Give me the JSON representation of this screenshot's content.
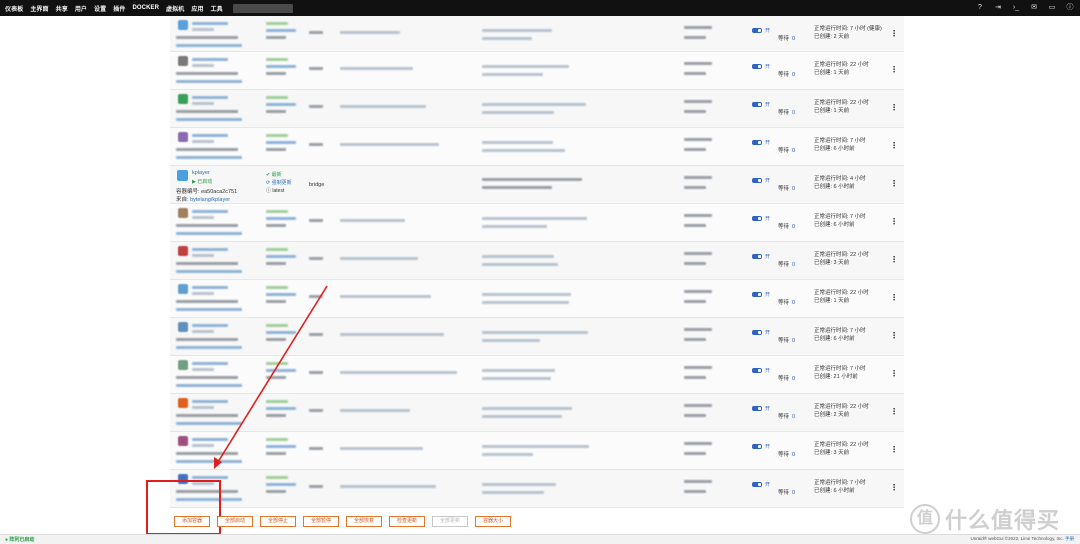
{
  "nav": {
    "items": [
      "仪表板",
      "主界面",
      "共享",
      "用户",
      "设置",
      "插件",
      "DOCKER",
      "虚拟机",
      "应用",
      "工具"
    ],
    "active": "DOCKER"
  },
  "top_icons": [
    "help-icon",
    "logout-icon",
    "terminal-icon",
    "feedback-icon",
    "monitor-icon",
    "info-icon"
  ],
  "containers": [
    {
      "uptime_line1": "正常运行时间: 7 小时 (健康)",
      "uptime_line2": "已创建: 2 天前",
      "wait": "等待",
      "wait_value": "0",
      "autostart": "开"
    },
    {
      "uptime_line1": "正常运行时间: 22 小时",
      "uptime_line2": "已创建: 1 天前",
      "wait": "等待",
      "wait_value": "0",
      "autostart": "开"
    },
    {
      "uptime_line1": "正常运行时间: 22 小时",
      "uptime_line2": "已创建: 1 天前",
      "wait": "等待",
      "wait_value": "0",
      "autostart": "开"
    },
    {
      "uptime_line1": "正常运行时间: 7 小时",
      "uptime_line2": "已创建: 6 小时前",
      "wait": "等待",
      "wait_value": "0",
      "autostart": "开"
    },
    {
      "uptime_line1": "正常运行时间: 4 小时",
      "uptime_line2": "已创建: 6 小时前",
      "wait": "等待",
      "wait_value": "0",
      "autostart": "开"
    },
    {
      "uptime_line1": "正常运行时间: 7 小时",
      "uptime_line2": "已创建: 6 小时前",
      "wait": "等待",
      "wait_value": "0",
      "autostart": "开"
    },
    {
      "uptime_line1": "正常运行时间: 22 小时",
      "uptime_line2": "已创建: 3 天前",
      "wait": "等待",
      "wait_value": "0",
      "autostart": "开"
    },
    {
      "uptime_line1": "正常运行时间: 22 小时",
      "uptime_line2": "已创建: 1 天前",
      "wait": "等待",
      "wait_value": "0",
      "autostart": "开"
    },
    {
      "uptime_line1": "正常运行时间: 7 小时",
      "uptime_line2": "已创建: 6 小时前",
      "wait": "等待",
      "wait_value": "0",
      "autostart": "开"
    },
    {
      "uptime_line1": "正常运行时间: 7 小时",
      "uptime_line2": "已创建: 21 小时前",
      "wait": "等待",
      "wait_value": "0",
      "autostart": "开"
    },
    {
      "uptime_line1": "正常运行时间: 22 小时",
      "uptime_line2": "已创建: 2 天前",
      "wait": "等待",
      "wait_value": "0",
      "autostart": "开"
    },
    {
      "uptime_line1": "正常运行时间: 22 小时",
      "uptime_line2": "已创建: 3 天前",
      "wait": "等待",
      "wait_value": "0",
      "autostart": "开"
    },
    {
      "uptime_line1": "正常运行时间: 7 小时",
      "uptime_line2": "已创建: 6 小时前",
      "wait": "等待",
      "wait_value": "0",
      "autostart": "开"
    }
  ],
  "kplayer": {
    "name": "kplayer",
    "status": "已启动",
    "id_label": "容器编号:",
    "id_value": "ea50aca2c751",
    "source_label": "来自:",
    "source_value": "bytelang/kplayer",
    "update_status": "最新",
    "update_action": "强制更新",
    "version": "latest",
    "network": "bridge"
  },
  "buttons": [
    {
      "label": "添加容器",
      "enabled": true
    },
    {
      "label": "全部启动",
      "enabled": true
    },
    {
      "label": "全部停止",
      "enabled": true
    },
    {
      "label": "全部暂停",
      "enabled": true
    },
    {
      "label": "全部恢复",
      "enabled": true
    },
    {
      "label": "检查更新",
      "enabled": true
    },
    {
      "label": "全部更新",
      "enabled": false
    },
    {
      "label": "容器大小",
      "enabled": true
    }
  ],
  "footer": {
    "status": "阵列已启动",
    "copyright": "Unraid® webGui ©2022, Lime Technology, Inc.",
    "manual": "手册"
  },
  "watermark": {
    "logo": "值",
    "text": "什么值得买"
  },
  "colors": {
    "accent_blue": "#2f63c4",
    "button_orange": "#e2762f",
    "highlight_red": "#e01e1e",
    "status_green": "#2a9d47"
  }
}
